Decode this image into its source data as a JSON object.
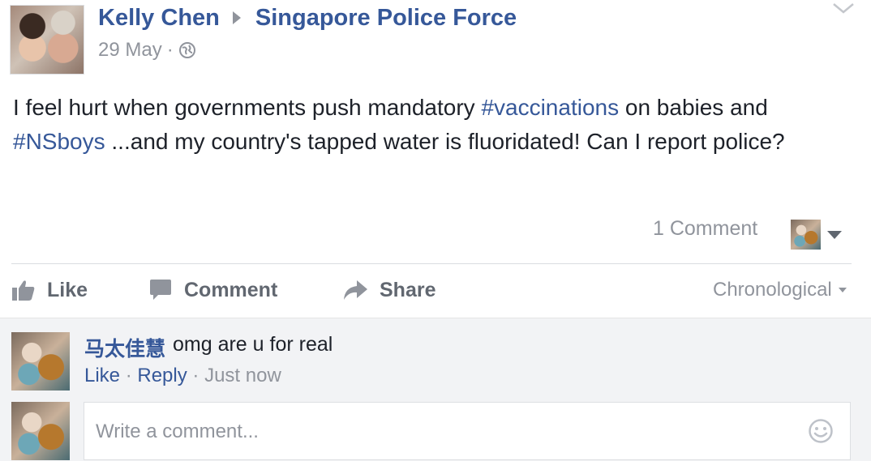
{
  "post": {
    "author": "Kelly Chen",
    "target": "Singapore Police Force",
    "date": "29 May",
    "separator": "·",
    "text_part1": "I feel hurt when governments push mandatory ",
    "hashtag1": "#vaccinations",
    "text_part2": " on babies and ",
    "hashtag2": "#NSboys",
    "text_part3": " ...and my country's tapped water is fluoridated! Can I report police?",
    "comment_count": "1 Comment"
  },
  "actions": {
    "like": "Like",
    "comment": "Comment",
    "share": "Share",
    "sort": "Chronological"
  },
  "comments": [
    {
      "author": "马太佳慧",
      "text": "omg are u for real",
      "like": "Like",
      "reply": "Reply",
      "time": "Just now"
    }
  ],
  "composer": {
    "placeholder": "Write a comment..."
  },
  "icons": {
    "privacy": "globe-icon",
    "options": "chevron-down-icon",
    "like": "thumbs-up-icon",
    "comment": "speech-bubble-icon",
    "share": "share-arrow-icon",
    "emoji": "smiley-icon"
  },
  "colors": {
    "link": "#365899",
    "muted": "#90949c",
    "text": "#1d2129",
    "action": "#616770"
  }
}
